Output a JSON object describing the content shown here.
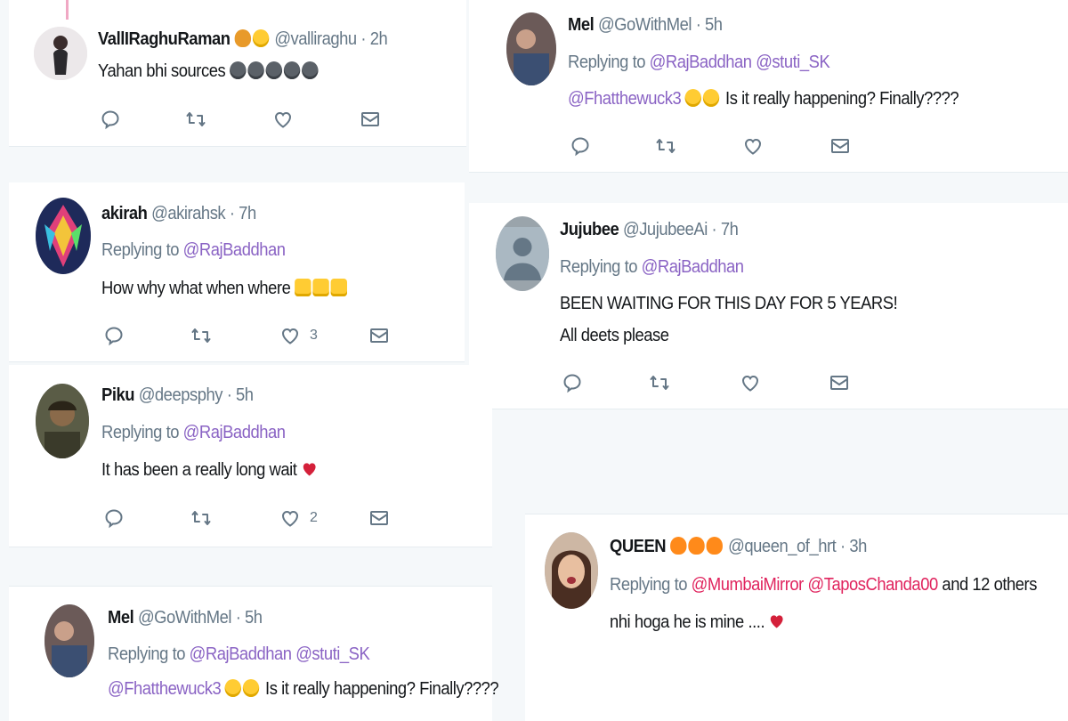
{
  "tweets": {
    "valli": {
      "name": "VallIRaghuRaman",
      "handle": "@valliraghu",
      "time": "2h",
      "text": "Yahan bhi sources"
    },
    "mel_top": {
      "name": "Mel",
      "handle": "@GoWithMel",
      "time": "5h",
      "replying_label": "Replying to",
      "mention1": "@RajBaddhan",
      "mention2": "@stuti_SK",
      "mention3": "@Fhatthewuck3",
      "text": "Is it really happening? Finally????"
    },
    "akirah": {
      "name": "akirah",
      "handle": "@akirahsk",
      "time": "7h",
      "replying_label": "Replying to",
      "mention1": "@RajBaddhan",
      "text": "How why what when where",
      "like_count": "3"
    },
    "jujubee": {
      "name": "Jujubee",
      "handle": "@JujubeeAi",
      "time": "7h",
      "replying_label": "Replying to",
      "mention1": "@RajBaddhan",
      "text1": "BEEN WAITING FOR THIS DAY FOR 5 YEARS!",
      "text2": "All deets please"
    },
    "piku": {
      "name": "Piku",
      "handle": "@deepsphy",
      "time": "5h",
      "replying_label": "Replying to",
      "mention1": "@RajBaddhan",
      "text": "It has been a really long wait",
      "like_count": "2"
    },
    "queen": {
      "name": "QUEEN",
      "handle": "@queen_of_hrt",
      "time": "3h",
      "replying_label": "Replying to",
      "mention1": "@MumbaiMirror",
      "mention2": "@TaposChanda00",
      "others": "and 12 others",
      "text": "nhi hoga he is mine ...."
    },
    "mel_bottom": {
      "name": "Mel",
      "handle": "@GoWithMel",
      "time": "5h",
      "replying_label": "Replying to",
      "mention1": "@RajBaddhan",
      "mention2": "@stuti_SK",
      "mention3": "@Fhatthewuck3",
      "text": "Is it really happening? Finally????"
    }
  },
  "separator": "·",
  "colors": {
    "mention": "#8a63c4",
    "mention_red": "#e0245e",
    "muted": "#657786",
    "heart": "#d4203a"
  },
  "icons": [
    "reply-icon",
    "retweet-icon",
    "like-icon",
    "message-icon"
  ]
}
